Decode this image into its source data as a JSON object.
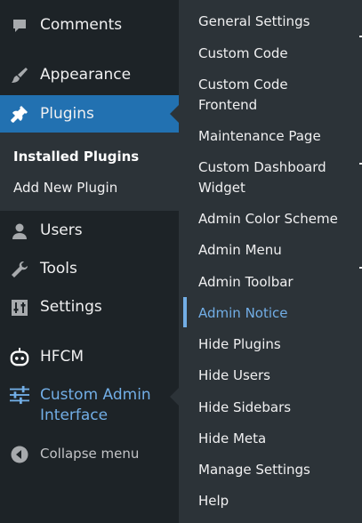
{
  "menu": {
    "comments": "Comments",
    "appearance": "Appearance",
    "plugins": "Plugins",
    "users": "Users",
    "tools": "Tools",
    "settings": "Settings",
    "hfcm": "HFCM",
    "custom_admin_line1": "Custom Admin",
    "custom_admin_line2": "Interface",
    "collapse": "Collapse menu"
  },
  "plugins_submenu": {
    "installed": "Installed Plugins",
    "add_new": "Add New Plugin"
  },
  "flyout": {
    "items": [
      "General Settings",
      "Custom Code",
      "Custom Code",
      "Frontend",
      "Maintenance Page",
      "Custom Dashboard",
      "Widget",
      "Admin Color Scheme",
      "Admin Menu",
      "Admin Toolbar",
      "Admin Notice",
      "Hide Plugins",
      "Hide Users",
      "Hide Sidebars",
      "Hide Meta",
      "Manage Settings",
      "Help"
    ],
    "selected": "Admin Notice"
  },
  "colors": {
    "sidebar_bg": "#1d2327",
    "submenu_bg": "#2c3338",
    "active_bg": "#2271b1",
    "accent_text": "#72aee6"
  }
}
